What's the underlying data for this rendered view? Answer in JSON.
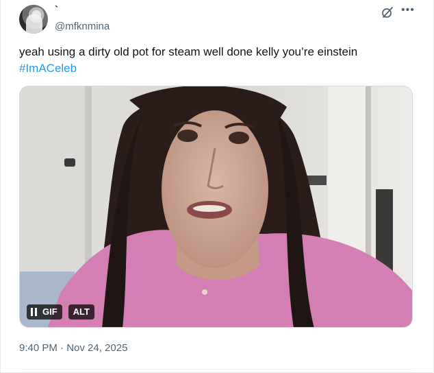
{
  "author": {
    "display_name": "`",
    "handle": "@mfknmina"
  },
  "icons": {
    "grok": "grok-icon",
    "more": "more-icon",
    "pause": "pause-icon"
  },
  "tweet": {
    "text": "yeah using a dirty old pot for steam well done kelly you’re einstein",
    "hashtag": "#ImACeleb"
  },
  "media": {
    "gif_label": "GIF",
    "alt_label": "ALT"
  },
  "footer": {
    "timestamp": "9:40 PM · Nov 24, 2025"
  },
  "colors": {
    "text": "#0f1419",
    "secondary": "#536471",
    "link": "#1d9bf0"
  }
}
